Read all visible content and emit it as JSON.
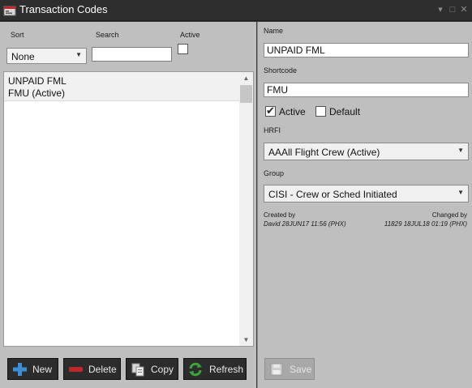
{
  "window": {
    "title": "Transaction Codes",
    "controls": [
      "dropdown",
      "maximize",
      "close"
    ]
  },
  "filters": {
    "sort_label": "Sort",
    "sort_value": "None",
    "search_label": "Search",
    "search_value": "",
    "active_label": "Active",
    "active_checked": false
  },
  "list": {
    "items": [
      {
        "name": "UNPAID FML",
        "detail": "FMU  (Active)"
      }
    ]
  },
  "buttons": {
    "new": "New",
    "delete": "Delete",
    "copy": "Copy",
    "refresh": "Refresh",
    "save": "Save"
  },
  "detail": {
    "name_label": "Name",
    "name_value": "UNPAID FML",
    "shortcode_label": "Shortcode",
    "shortcode_value": "FMU",
    "active_label": "Active",
    "active_checked": true,
    "default_label": "Default",
    "default_checked": false,
    "hrfi_label": "HRFI",
    "hrfi_value": "AAAll Flight Crew (Active)",
    "group_label": "Group",
    "group_value": "CISI - Crew or Sched Initiated",
    "created_label": "Created by",
    "created_value": "David  28JUN17 11:56 (PHX)",
    "changed_label": "Changed by",
    "changed_value": "11829  18JUL18 01:19 (PHX)"
  },
  "colors": {
    "titlebar": "#2e2e2e",
    "panel": "#bfbfbf",
    "button_dark": "#2c2c2c",
    "icon_new": "#3b8fd6",
    "icon_delete": "#c0262a",
    "icon_refresh": "#3aa63a"
  },
  "icons": {
    "app": "app-icon",
    "new": "plus-icon",
    "delete": "minus-icon",
    "copy": "copy-icon",
    "refresh": "refresh-icon",
    "save": "floppy-disk-icon"
  }
}
